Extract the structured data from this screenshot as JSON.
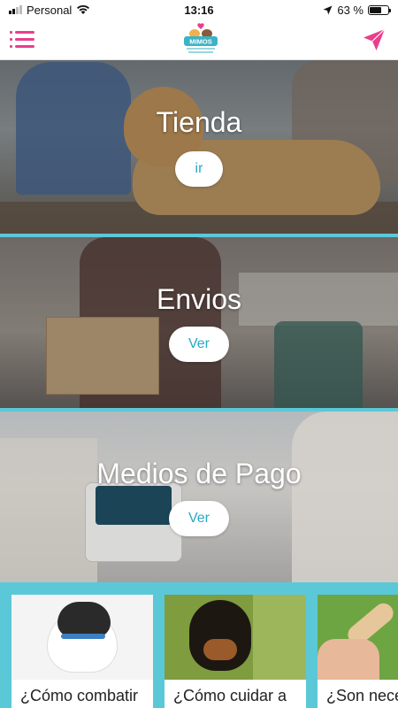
{
  "status_bar": {
    "carrier": "Personal",
    "time": "13:16",
    "battery_percent": "63 %",
    "battery_level": 0.63
  },
  "header": {
    "logo_text": "MIMOS",
    "icons": {
      "menu": "menu-list-icon",
      "send": "paper-plane-icon"
    },
    "accent_color": "#e83e8c"
  },
  "sections": [
    {
      "title": "Tienda",
      "button_label": "ir"
    },
    {
      "title": "Envios",
      "button_label": "Ver"
    },
    {
      "title": "Medios de Pago",
      "button_label": "Ver"
    }
  ],
  "blog": {
    "background_color": "#5bc8d8",
    "cards": [
      {
        "caption": "¿Cómo combatir"
      },
      {
        "caption": "¿Cómo cuidar a"
      },
      {
        "caption": "¿Son nece"
      }
    ]
  },
  "colors": {
    "divider": "#5bc8d8",
    "button_text": "#29a9c2"
  }
}
